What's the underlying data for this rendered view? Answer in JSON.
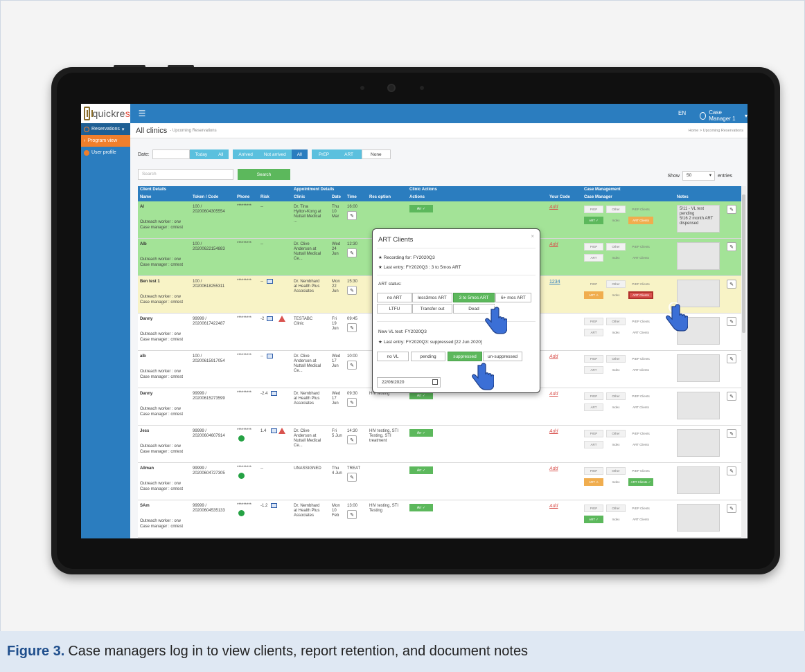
{
  "app": {
    "logo_text_a": "quickre",
    "logo_text_b": "s",
    "lang": "EN",
    "user": "Case Manager 1"
  },
  "sidebar": {
    "items": [
      {
        "label": "Reservations"
      },
      {
        "label": "Program view"
      },
      {
        "label": "User profile"
      }
    ]
  },
  "page": {
    "title": "All clinics",
    "subtitle": "- Upcoming Reservations",
    "breadcrumb": "Home  >  Upcoming Reservations"
  },
  "filters": {
    "date_label": "Date:",
    "today": "Today",
    "all1": "All",
    "arrived": "Arrived",
    "not_arrived": "Not arrived",
    "all2": "All",
    "prep": "PrEP",
    "art": "ART",
    "none": "None"
  },
  "search": {
    "placeholder": "Search",
    "button": "Search",
    "show": "Show",
    "entries_value": "50",
    "entries": "entries"
  },
  "table": {
    "groups": {
      "client": "Client Details",
      "appointment": "Appointment Details",
      "clinic_actions": "Clinic Actions",
      "case_mgmt": "Case Management"
    },
    "headers": {
      "name": "Name",
      "token": "Token / Code",
      "phone": "Phone",
      "risk": "Risk",
      "clinic": "Clinic",
      "date": "Date",
      "time": "Time",
      "res_option": "Res option",
      "actions": "Actions",
      "your_code": "Your Code",
      "case_manager": "Case Manager",
      "notes": "Notes"
    },
    "rows": [
      {
        "name": "Al",
        "token": "100 /",
        "code": "20200604305554",
        "outreach": "Outreach worker : orw",
        "casemgr": "Case manager : cmtest",
        "phone": "*********",
        "risk": "--",
        "clinic1": "Dr. Tina",
        "clinic2": "Hylton-Kong at",
        "clinic3": "Nuttall Medical",
        "clinic4": "...",
        "day": "Thu",
        "dnum": "10",
        "mon": "Mar",
        "time": "16:00",
        "res": "",
        "arr": "Arr ✓",
        "yourcode": "Add",
        "notes": "5/11 - VL test pending\n5/16 2 month ART dispensed"
      },
      {
        "name": "Alb",
        "token": "100 /",
        "code": "20200622154883",
        "outreach": "Outreach worker : orw",
        "casemgr": "Case manager : cmtest",
        "phone": "*********",
        "risk": "--",
        "clinic1": "Dr. Clive",
        "clinic2": "Anderson at",
        "clinic3": "Nuttall Medical",
        "clinic4": "Ce...",
        "day": "Wed",
        "dnum": "24",
        "mon": "Jun",
        "time": "12:30",
        "res": "",
        "arr": "",
        "yourcode": "Add",
        "notes": ""
      },
      {
        "name": "Ben test 1",
        "token": "100 /",
        "code": "20200618255311",
        "outreach": "Outreach worker : orw",
        "casemgr": "Case manager : cmtest",
        "phone": "*********",
        "risk": "--",
        "clinic1": "Dr. Nembhard",
        "clinic2": "at Health Plus",
        "clinic3": "Associates",
        "clinic4": "",
        "day": "Mon",
        "dnum": "22",
        "mon": "Jun",
        "time": "15:30",
        "res": "",
        "arr": "",
        "yourcode": "1234",
        "notes": ""
      },
      {
        "name": "Danny",
        "token": "99999 /",
        "code": "20200617422487",
        "outreach": "Outreach worker : orw",
        "casemgr": "Case manager : cmtest",
        "phone": "*********",
        "risk": "-2",
        "clinic1": "TESTABC",
        "clinic2": "Clinic",
        "clinic3": "",
        "clinic4": "",
        "day": "Fri",
        "dnum": "19",
        "mon": "Jun",
        "time": "09:45",
        "res": "",
        "arr": "",
        "yourcode": "",
        "notes": ""
      },
      {
        "name": "alb",
        "token": "100 /",
        "code": "20200615917054",
        "outreach": "Outreach worker : orw",
        "casemgr": "Case manager : cmtest",
        "phone": "*********",
        "risk": "--",
        "clinic1": "Dr. Clive",
        "clinic2": "Anderson at",
        "clinic3": "Nuttall Medical",
        "clinic4": "Ce...",
        "day": "Wed",
        "dnum": "17",
        "mon": "Jun",
        "time": "10:00",
        "res": "",
        "arr": "",
        "yourcode": "Add",
        "notes": ""
      },
      {
        "name": "Danny",
        "token": "99999 /",
        "code": "20200615273599",
        "outreach": "Outreach worker : orw",
        "casemgr": "Case manager : cmtest",
        "phone": "*********",
        "risk": "-2.4",
        "clinic1": "Dr. Nembhard",
        "clinic2": "at Health Plus",
        "clinic3": "Associates",
        "clinic4": "",
        "day": "Wed",
        "dnum": "17",
        "mon": "Jun",
        "time": "09:30",
        "res": "HIV testing",
        "arr": "Arr ✓",
        "yourcode": "Add",
        "notes": ""
      },
      {
        "name": "Jess",
        "token": "99999 /",
        "code": "20200604607914",
        "outreach": "Outreach worker : orw",
        "casemgr": "Case manager : cmtest",
        "phone": "*********",
        "risk": "1.4",
        "clinic1": "Dr. Clive",
        "clinic2": "Anderson at",
        "clinic3": "Nuttall Medical",
        "clinic4": "Ce...",
        "day": "Fri",
        "dnum": "5 Jun",
        "mon": "",
        "time": "14:30",
        "res": "HIV testing, STI Testing, STI treatment",
        "arr": "Arr ✓",
        "yourcode": "Add",
        "notes": ""
      },
      {
        "name": "Allman",
        "token": "99999 /",
        "code": "20200604727305",
        "outreach": "Outreach worker : orw",
        "casemgr": "Case manager : cmtest",
        "phone": "*********",
        "risk": "--",
        "clinic1": "UNASSIGNED",
        "clinic2": "",
        "clinic3": "",
        "clinic4": "",
        "day": "Thu",
        "dnum": "4 Jun",
        "mon": "",
        "time": "TREAT",
        "res": "",
        "arr": "Arr ✓",
        "yourcode": "Add",
        "notes": ""
      },
      {
        "name": "SAm",
        "token": "99999 /",
        "code": "20200604535133",
        "outreach": "Outreach worker : orw",
        "casemgr": "Case manager : cmtest",
        "phone": "*********",
        "risk": "-1.2",
        "clinic1": "Dr. Nembhard",
        "clinic2": "at Health Plus",
        "clinic3": "Associates",
        "clinic4": "",
        "day": "Mon",
        "dnum": "10",
        "mon": "Feb",
        "time": "13:00",
        "res": "HIV testing, STI Testing",
        "arr": "Arr ✓",
        "yourcode": "Add",
        "notes": ""
      }
    ],
    "cm_labels": {
      "prep": "PrEP",
      "other": "Other",
      "prep_clients": "PrEP Clients",
      "art": "ART",
      "art_check": "ART ✓",
      "art_warn": "ART ⚠",
      "index": "Index",
      "art_clients": "ART Clients",
      "art_clients_check": "ART Clients ✓"
    }
  },
  "modal": {
    "title": "ART Clients",
    "close": "×",
    "recording": "★ Recording for: FY2020Q3",
    "last_entry": "★ Last entry: FY2020Q3 : 3 to 5mos ART",
    "art_status": "ART status:",
    "art_options": [
      "no ART",
      "less3mos ART",
      "3 to 5mos ART",
      "6+ mos ART",
      "LTFU",
      "Transfer out",
      "Dead"
    ],
    "vl_title": "New VL test: FY2020Q3",
    "vl_last": "★ Last entry: FY2020Q3: suppressed [22 Jun 2020]",
    "vl_options": [
      "no VL",
      "pending",
      "suppressed",
      "un-suppressed"
    ],
    "date_value": "22/06/2020"
  },
  "caption": {
    "label": "Figure 3.",
    "text": "Case managers log in to view clients, report retention, and document notes"
  },
  "colors": {
    "primary": "#2b7dbf",
    "green_row": "#a3e397",
    "yellow_row": "#f8f3c6",
    "success": "#5cb85c",
    "warning": "#f0ad4e",
    "danger": "#d9534f"
  }
}
